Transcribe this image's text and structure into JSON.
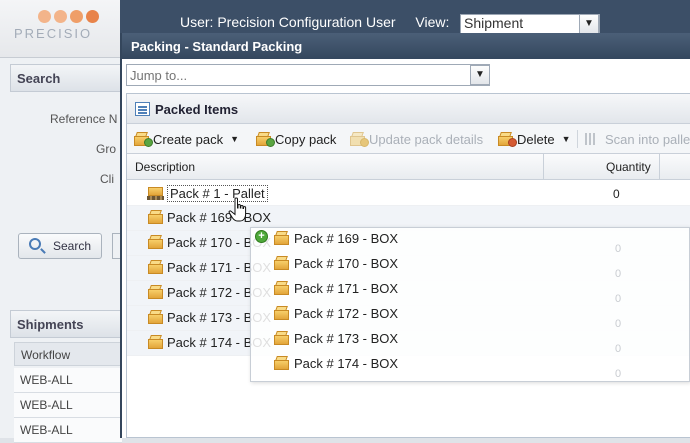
{
  "app": {
    "logo_text": "PRECISIO",
    "user_line": "User: Precision Configuration User",
    "view_label": "View:",
    "view_value": "Shipment"
  },
  "left": {
    "search_title": "Search",
    "labels": [
      "Reference N",
      "Gro",
      "Cli"
    ],
    "search_button": "Search",
    "shipments_title": "Shipments",
    "workflow_header": "Workflow",
    "workflow_rows": [
      "WEB-ALL",
      "WEB-ALL",
      "WEB-ALL"
    ]
  },
  "modal": {
    "title": "Packing - Standard Packing",
    "jump_placeholder": "Jump to...",
    "panel_title": "Packed Items",
    "toolbar": {
      "create_pack": "Create pack",
      "copy_pack": "Copy pack",
      "update_pack": "Update pack details",
      "delete": "Delete",
      "scan": "Scan into pallet"
    },
    "columns": {
      "description": "Description",
      "quantity": "Quantity"
    },
    "rows": [
      {
        "label": "Pack # 1 - Pallet",
        "qty": "0",
        "icon": "pallet-icon"
      },
      {
        "label": "Pack # 169 - BOX",
        "qty": "",
        "icon": "box-icon"
      },
      {
        "label": "Pack # 170 - BOX",
        "qty": "",
        "icon": "box-icon"
      },
      {
        "label": "Pack # 171 - BOX",
        "qty": "",
        "icon": "box-icon"
      },
      {
        "label": "Pack # 172 - BOX",
        "qty": "",
        "icon": "box-icon"
      },
      {
        "label": "Pack # 173 - BOX",
        "qty": "",
        "icon": "box-icon"
      },
      {
        "label": "Pack # 174 - BOX",
        "qty": "",
        "icon": "box-icon"
      }
    ],
    "drag_ghost": {
      "rows": [
        "Pack # 169 - BOX",
        "Pack # 170 - BOX",
        "Pack # 171 - BOX",
        "Pack # 172 - BOX",
        "Pack # 173 - BOX",
        "Pack # 174 - BOX"
      ],
      "qty": [
        "0",
        "0",
        "0",
        "0",
        "0",
        "0"
      ]
    }
  }
}
